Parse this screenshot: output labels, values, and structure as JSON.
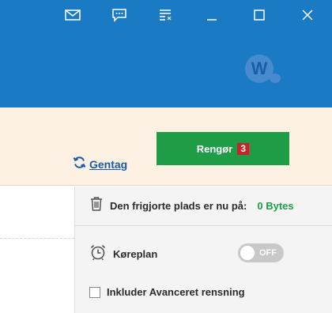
{
  "header": {
    "avatar_initial": "W",
    "bg_color": "#1a7ac3"
  },
  "titlebar_icons": [
    "mail-icon",
    "chat-icon",
    "menu-icon",
    "minimize-icon",
    "maximize-icon",
    "close-icon"
  ],
  "actions": {
    "clean_label": "Rengør",
    "clean_count": "3",
    "retry_label": "Gentag",
    "accent": "#1f9d46"
  },
  "panel": {
    "freed_label": "Den frigjorte plads er nu på:",
    "freed_value": "0 Bytes",
    "schedule_label": "Køreplan",
    "schedule_toggle": "OFF",
    "advanced_label": "Inkluder Avanceret rensning"
  }
}
